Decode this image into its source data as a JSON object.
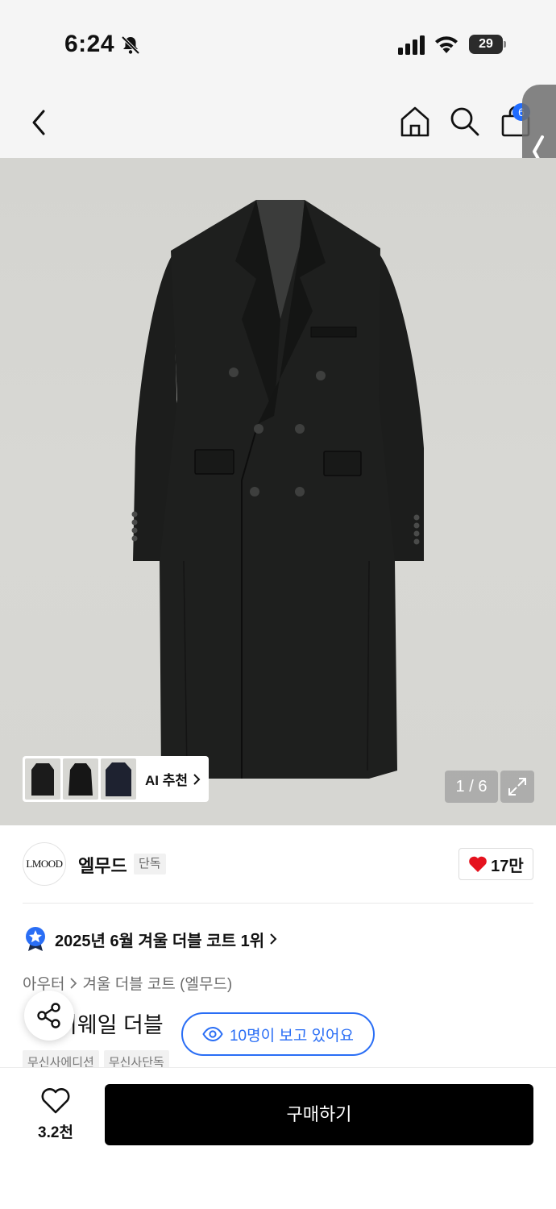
{
  "status_bar": {
    "time": "6:24",
    "battery": "29"
  },
  "nav": {
    "cart_count": "6"
  },
  "gallery": {
    "page_indicator": "1 / 6",
    "ai_recommend_label": "AI 추천"
  },
  "brand": {
    "logo_text": "LMOOD",
    "name": "엘무드",
    "badge": "단독",
    "like_count": "17만"
  },
  "ranking": {
    "text": "2025년 6월 겨울 더블 코트 1위"
  },
  "breadcrumb": {
    "items": [
      "아우터",
      "겨울 더블 코트 (엘무드)"
    ]
  },
  "product": {
    "title_visible": "이웨일 더블",
    "title_prefix": "·"
  },
  "viewers": {
    "text": "10명이 보고 있어요"
  },
  "tags": [
    "무신사에디션",
    "무신사단독"
  ],
  "bottom_bar": {
    "wish_count": "3.2천",
    "buy_label": "구매하기"
  },
  "colors": {
    "accent_blue": "#2a6ef5",
    "badge_blue": "#1f6bff",
    "heart_red": "#e5121e"
  }
}
